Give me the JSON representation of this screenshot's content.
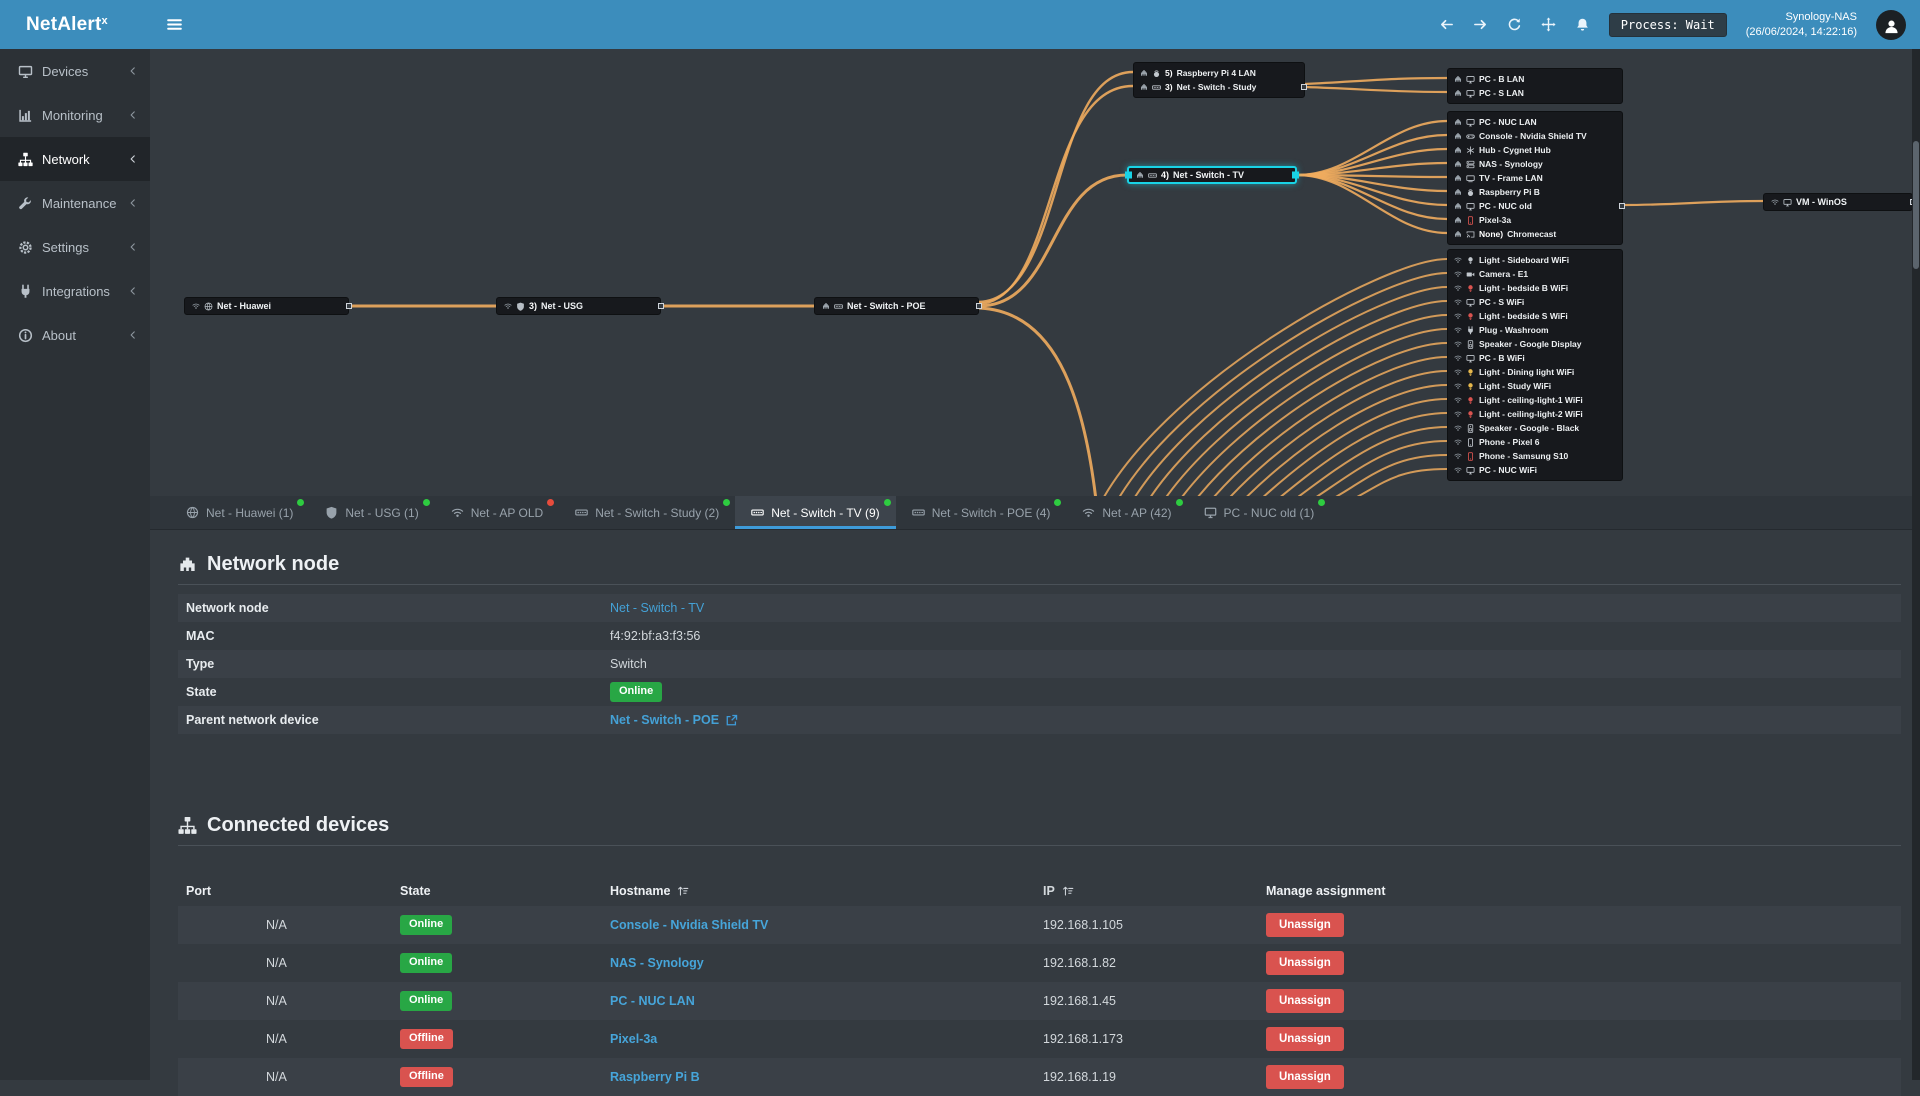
{
  "app": {
    "brand": "NetAlert",
    "brand_sup": "x"
  },
  "topbar": {
    "process_badge": "Process: Wait",
    "host": "Synology-NAS",
    "timestamp": "(26/06/2024, 14:22:16)"
  },
  "sidebar": {
    "items": [
      {
        "label": "Devices",
        "icon": "i-monitor"
      },
      {
        "label": "Monitoring",
        "icon": "i-chart"
      },
      {
        "label": "Network",
        "icon": "i-sitemap3",
        "active": true
      },
      {
        "label": "Maintenance",
        "icon": "i-wrench"
      },
      {
        "label": "Settings",
        "icon": "i-gear"
      },
      {
        "label": "Integrations",
        "icon": "i-plug"
      },
      {
        "label": "About",
        "icon": "i-info"
      }
    ]
  },
  "diagram": {
    "chain": [
      {
        "id": "huawei",
        "label": "Net - Huawei",
        "conn": "wifi",
        "icon": "i-globe"
      },
      {
        "id": "usg",
        "label": "Net - USG",
        "prefix": "3)",
        "conn": "wifi",
        "icon": "i-shield"
      },
      {
        "id": "poe",
        "label": "Net - Switch - POE",
        "conn": "lan",
        "icon": "i-switch"
      }
    ],
    "selected": {
      "id": "tv",
      "label": "Net - Switch - TV",
      "prefix": "4)",
      "conn": "lan",
      "icon": "i-switch"
    },
    "vm": {
      "id": "vm",
      "label": "VM - WinOS",
      "conn": "wifi",
      "icon": "i-monitor"
    },
    "clusters": {
      "study": [
        {
          "label": "Raspberry Pi 4 LAN",
          "prefix": "5)",
          "conn": "lan",
          "icon": "i-berry"
        },
        {
          "label": "Net - Switch - Study",
          "prefix": "3)",
          "conn": "lan",
          "icon": "i-switch",
          "handle": true
        }
      ],
      "lan_bs": [
        {
          "label": "PC - B LAN",
          "conn": "lan",
          "icon": "i-monitor"
        },
        {
          "label": "PC - S LAN",
          "conn": "lan",
          "icon": "i-monitor"
        }
      ],
      "tv_devices": [
        {
          "label": "PC - NUC LAN",
          "conn": "lan",
          "icon": "i-monitor"
        },
        {
          "label": "Console - Nvidia Shield TV",
          "conn": "lan",
          "icon": "i-gamepad"
        },
        {
          "label": "Hub - Cygnet Hub",
          "conn": "lan",
          "icon": "i-hub"
        },
        {
          "label": "NAS - Synology",
          "conn": "lan",
          "icon": "i-server"
        },
        {
          "label": "TV - Frame LAN",
          "conn": "lan",
          "icon": "i-tv"
        },
        {
          "label": "Raspberry Pi B",
          "conn": "lan",
          "icon": "i-berry"
        },
        {
          "label": "PC - NUC old",
          "conn": "lan",
          "icon": "i-monitor",
          "handle": true
        },
        {
          "label": "Pixel-3a",
          "conn": "lan",
          "icon": "i-phone",
          "color": "#d9534f"
        },
        {
          "label": "Chromecast",
          "prefix": "None)",
          "conn": "lan",
          "icon": "i-cast"
        }
      ],
      "wifi_devices": [
        {
          "label": "Light - Sideboard WiFi",
          "conn": "wifi",
          "icon": "i-bulb"
        },
        {
          "label": "Camera - E1",
          "conn": "wifi",
          "icon": "i-camera"
        },
        {
          "label": "Light - bedside B WiFi",
          "conn": "wifi",
          "icon": "i-bulb",
          "color": "#d9534f"
        },
        {
          "label": "PC - S WiFi",
          "conn": "wifi",
          "icon": "i-monitor"
        },
        {
          "label": "Light - bedside S WiFi",
          "conn": "wifi",
          "icon": "i-bulb",
          "color": "#d9534f"
        },
        {
          "label": "Plug - Washroom",
          "conn": "wifi",
          "icon": "i-plug"
        },
        {
          "label": "Speaker - Google Display",
          "conn": "wifi",
          "icon": "i-speaker"
        },
        {
          "label": "PC - B WiFi",
          "conn": "wifi",
          "icon": "i-monitor"
        },
        {
          "label": "Light - Dining light WiFi",
          "conn": "wifi",
          "icon": "i-bulb",
          "color": "#e6b84c"
        },
        {
          "label": "Light - Study WiFi",
          "conn": "wifi",
          "icon": "i-bulb",
          "color": "#e6b84c"
        },
        {
          "label": "Light - ceiling-light-1 WiFi",
          "conn": "wifi",
          "icon": "i-bulb",
          "color": "#d9534f"
        },
        {
          "label": "Light - ceiling-light-2 WiFi",
          "conn": "wifi",
          "icon": "i-bulb",
          "color": "#d9534f"
        },
        {
          "label": "Speaker - Google - Black",
          "conn": "wifi",
          "icon": "i-speaker"
        },
        {
          "label": "Phone - Pixel 6",
          "conn": "wifi",
          "icon": "i-phone"
        },
        {
          "label": "Phone - Samsung S10",
          "conn": "wifi",
          "icon": "i-phone",
          "color": "#d9534f"
        },
        {
          "label": "PC - NUC WiFi",
          "conn": "wifi",
          "icon": "i-monitor"
        }
      ]
    }
  },
  "tabs": [
    {
      "label": "Net - Huawei (1)",
      "icon": "i-globe",
      "status": "online"
    },
    {
      "label": "Net - USG (1)",
      "icon": "i-shield",
      "status": "online"
    },
    {
      "label": "Net - AP OLD",
      "icon": "i-wifi",
      "status": "offline"
    },
    {
      "label": "Net - Switch - Study (2)",
      "icon": "i-switch",
      "status": "online"
    },
    {
      "label": "Net - Switch - TV (9)",
      "icon": "i-switch",
      "status": "online",
      "active": true
    },
    {
      "label": "Net - Switch - POE (4)",
      "icon": "i-switch",
      "status": "online"
    },
    {
      "label": "Net - AP (42)",
      "icon": "i-wifi",
      "status": "online"
    },
    {
      "label": "PC - NUC old (1)",
      "icon": "i-monitor",
      "status": "online"
    }
  ],
  "network_node": {
    "title": "Network node",
    "rows": [
      {
        "label": "Network node",
        "value": "Net - Switch - TV",
        "type": "link"
      },
      {
        "label": "MAC",
        "value": "f4:92:bf:a3:f3:56",
        "type": "text"
      },
      {
        "label": "Type",
        "value": "Switch",
        "type": "text"
      },
      {
        "label": "State",
        "value": "Online",
        "type": "badge"
      },
      {
        "label": "Parent network device",
        "value": "Net - Switch - POE",
        "type": "link-external"
      }
    ]
  },
  "connected_devices": {
    "title": "Connected devices",
    "columns": [
      {
        "label": "Port"
      },
      {
        "label": "State"
      },
      {
        "label": "Hostname",
        "sortable": true
      },
      {
        "label": "IP",
        "sortable": true
      },
      {
        "label": "Manage assignment"
      }
    ],
    "unassign_label": "Unassign",
    "rows": [
      {
        "port": "N/A",
        "state": "Online",
        "hostname": "Console - Nvidia Shield TV",
        "ip": "192.168.1.105"
      },
      {
        "port": "N/A",
        "state": "Online",
        "hostname": "NAS - Synology",
        "ip": "192.168.1.82"
      },
      {
        "port": "N/A",
        "state": "Online",
        "hostname": "PC - NUC LAN",
        "ip": "192.168.1.45"
      },
      {
        "port": "N/A",
        "state": "Offline",
        "hostname": "Pixel-3a",
        "ip": "192.168.1.173"
      },
      {
        "port": "N/A",
        "state": "Offline",
        "hostname": "Raspberry Pi B",
        "ip": "192.168.1.19"
      }
    ]
  }
}
